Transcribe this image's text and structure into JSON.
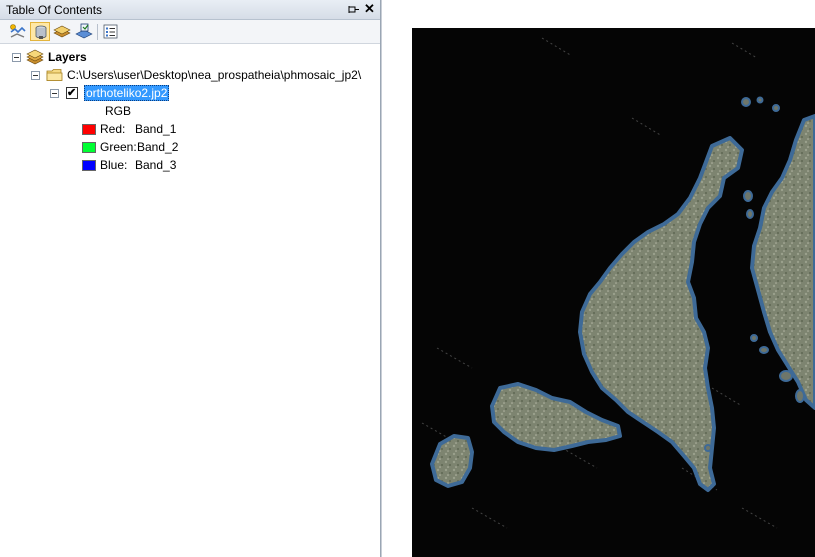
{
  "toc": {
    "title": "Table Of Contents",
    "close_glyph": "✕",
    "tree": {
      "root_label": "Layers",
      "folder_label": "C:\\Users\\user\\Desktop\\nea_prospatheia\\phmosaic_jp2\\",
      "layer_name": "orthoteliko2.jp2",
      "layer_checked": "✔",
      "render_label": "RGB",
      "bands": [
        {
          "channel": "Red:",
          "band": "Band_1",
          "color": "#ff0000"
        },
        {
          "channel": "Green:",
          "band": "Band_2",
          "color": "#00ff33"
        },
        {
          "channel": "Blue:",
          "band": "Band_3",
          "color": "#0000ff"
        }
      ]
    }
  },
  "colors": {
    "selection": "#3399ff",
    "map_background": "#050505",
    "land": "#7d8470",
    "coast": "#3e6a97"
  },
  "icons": [
    "pin-icon",
    "close-icon",
    "list-by-drawing-order-icon",
    "list-by-source-icon",
    "list-by-visibility-icon",
    "list-by-selection-icon",
    "options-icon",
    "layers-icon",
    "folder-icon"
  ]
}
